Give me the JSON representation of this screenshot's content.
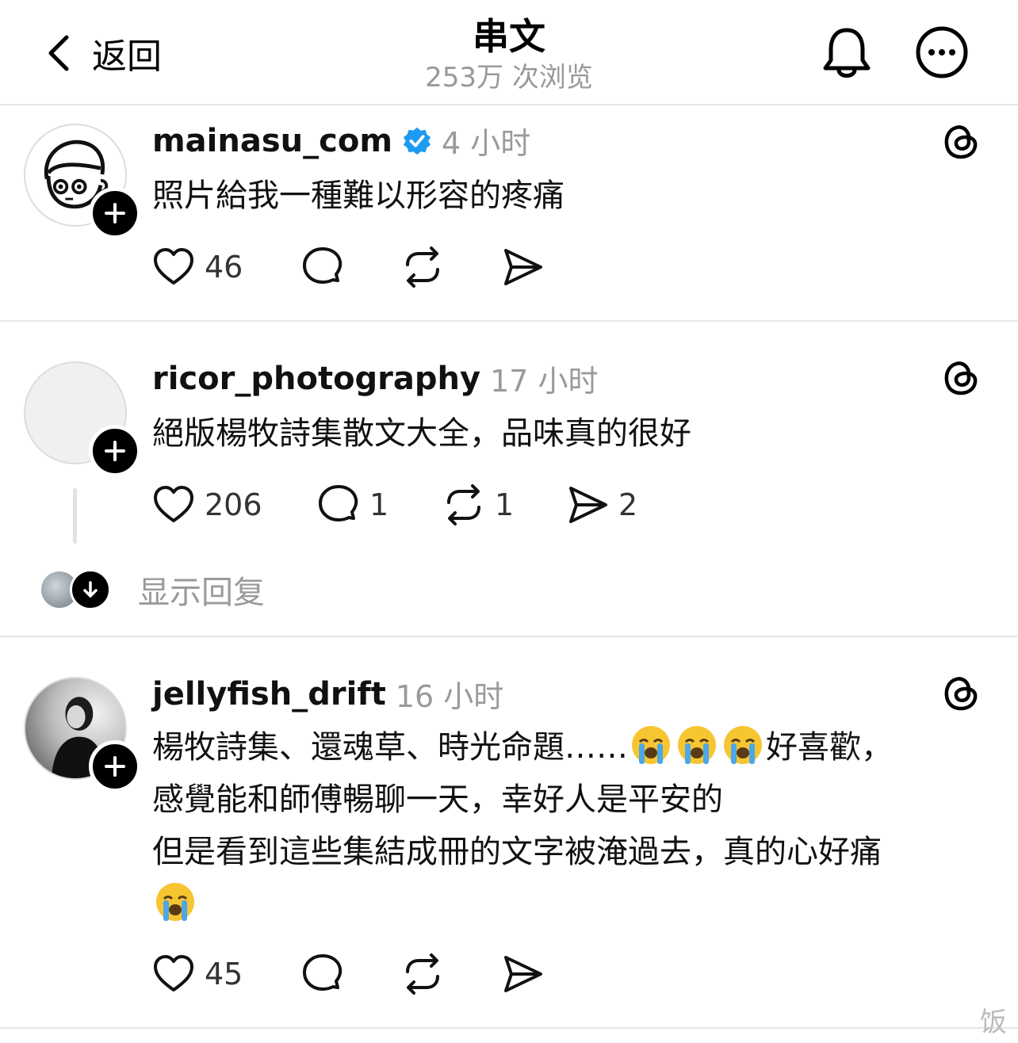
{
  "header": {
    "back_label": "返回",
    "title": "串文",
    "subtitle": "253万 次浏览"
  },
  "posts": [
    {
      "username": "mainasu_com",
      "verified": true,
      "time": "4 小时",
      "text": "照片給我一種難以形容的疼痛",
      "likes": "46",
      "comments": "",
      "reposts": "",
      "shares": "",
      "avatar_icon": "cartoon-face-avatar"
    },
    {
      "username": "ricor_photography",
      "verified": false,
      "time": "17 小时",
      "text": "絕版楊牧詩集散文大全，品味真的很好",
      "likes": "206",
      "comments": "1",
      "reposts": "1",
      "shares": "2",
      "show_replies": "显示回复"
    },
    {
      "username": "jellyfish_drift",
      "verified": false,
      "time": "16 小时",
      "text_line1": "楊牧詩集、還魂草、時光命題……",
      "text_line1_end": "好喜歡，",
      "text_line2": "感覺能和師傅暢聊一天，幸好人是平安的",
      "text_line3": "但是看到這些集結成冊的文字被淹過去，真的心好痛",
      "likes": "45",
      "comments": "",
      "reposts": "",
      "shares": ""
    }
  ],
  "watermark": "饭",
  "colors": {
    "verified": "#1d9bf0",
    "muted": "#9a9a9a",
    "divider": "#e6e6e6"
  }
}
